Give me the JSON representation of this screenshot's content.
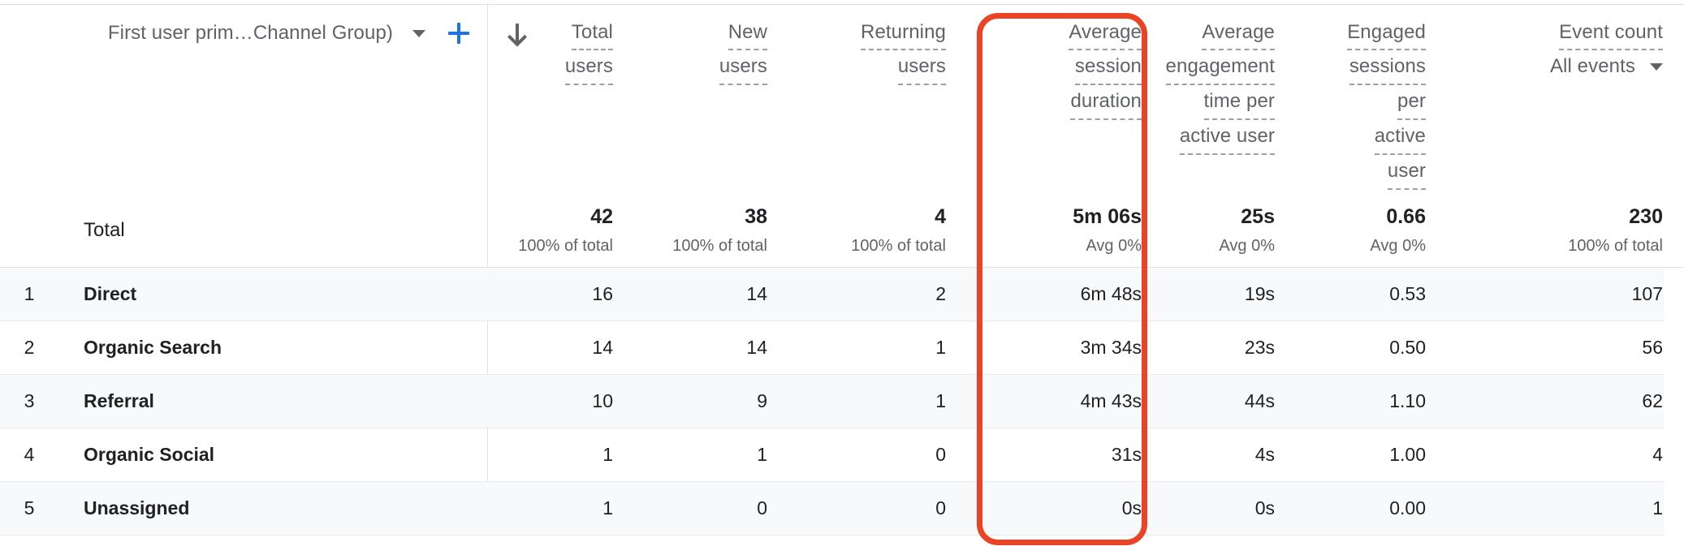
{
  "table": {
    "dimension_header": {
      "label": "First user prim…Channel Group)",
      "dropdown_icon": "chevron-down-icon",
      "add_icon": "plus-icon"
    },
    "sort_indicator": "arrow-down-icon",
    "metrics": [
      {
        "title": "Total users",
        "lines": [
          "Total",
          "users"
        ]
      },
      {
        "title": "New users",
        "lines": [
          "New",
          "users"
        ]
      },
      {
        "title": "Returning users",
        "lines": [
          "Returning",
          "users"
        ]
      },
      {
        "title": "Average session duration",
        "lines": [
          "Average",
          "session",
          "duration"
        ]
      },
      {
        "title": "Average engagement time per active user",
        "lines": [
          "Average",
          "engagement",
          "time per",
          "active user"
        ]
      },
      {
        "title": "Engaged sessions per active user",
        "lines": [
          "Engaged",
          "sessions",
          "per",
          "active",
          "user"
        ]
      },
      {
        "title": "Event count",
        "lines": [
          "Event count"
        ],
        "sub": "All events",
        "sub_icon": "chevron-down-icon"
      }
    ],
    "totals": {
      "label": "Total",
      "cells": [
        {
          "value": "42",
          "note": "100% of total"
        },
        {
          "value": "38",
          "note": "100% of total"
        },
        {
          "value": "4",
          "note": "100% of total"
        },
        {
          "value": "5m 06s",
          "note": "Avg 0%"
        },
        {
          "value": "25s",
          "note": "Avg 0%"
        },
        {
          "value": "0.66",
          "note": "Avg 0%"
        },
        {
          "value": "230",
          "note": "100% of total"
        }
      ]
    },
    "rows": [
      {
        "index": "1",
        "dimension": "Direct",
        "cells": [
          "16",
          "14",
          "2",
          "6m 48s",
          "19s",
          "0.53",
          "107"
        ]
      },
      {
        "index": "2",
        "dimension": "Organic Search",
        "cells": [
          "14",
          "14",
          "1",
          "3m 34s",
          "23s",
          "0.50",
          "56"
        ]
      },
      {
        "index": "3",
        "dimension": "Referral",
        "cells": [
          "10",
          "9",
          "1",
          "4m 43s",
          "44s",
          "1.10",
          "62"
        ]
      },
      {
        "index": "4",
        "dimension": "Organic Social",
        "cells": [
          "1",
          "1",
          "0",
          "31s",
          "4s",
          "1.00",
          "4"
        ]
      },
      {
        "index": "5",
        "dimension": "Unassigned",
        "cells": [
          "1",
          "0",
          "0",
          "0s",
          "0s",
          "0.00",
          "1"
        ]
      }
    ],
    "annotation": {
      "type": "rounded-rectangle-highlight",
      "color": "#ea4325",
      "targets_metric": "Average session duration"
    },
    "colors": {
      "accent": "#1a73e8",
      "highlight": "#ea4325",
      "row_alt_bg": "#f8f9fa",
      "text_primary": "#202124",
      "text_secondary": "#5f6368"
    }
  }
}
